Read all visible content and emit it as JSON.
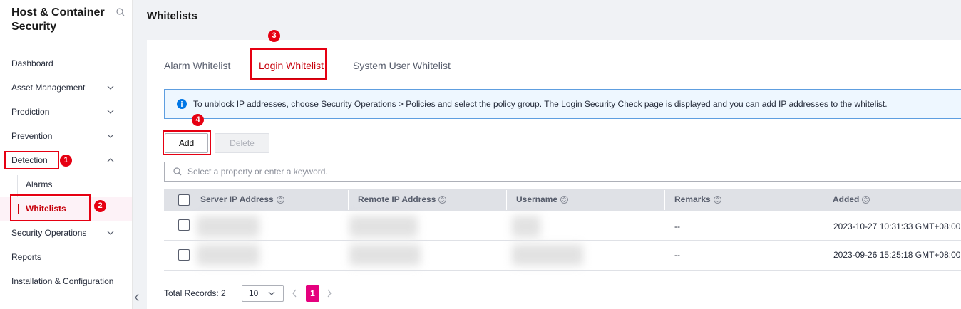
{
  "sidebar": {
    "title": "Host & Container Security",
    "items": [
      {
        "label": "Dashboard"
      },
      {
        "label": "Asset Management"
      },
      {
        "label": "Prediction"
      },
      {
        "label": "Prevention"
      },
      {
        "label": "Detection"
      },
      {
        "label": "Alarms"
      },
      {
        "label": "Whitelists"
      },
      {
        "label": "Security Operations"
      },
      {
        "label": "Reports"
      },
      {
        "label": "Installation & Configuration"
      }
    ]
  },
  "callouts": [
    "1",
    "2",
    "3",
    "4"
  ],
  "page": {
    "title": "Whitelists"
  },
  "tabs": [
    {
      "label": "Alarm Whitelist"
    },
    {
      "label": "Login Whitelist"
    },
    {
      "label": "System User Whitelist"
    }
  ],
  "info": {
    "text": "To unblock IP addresses, choose Security Operations > Policies and select the policy group. The Login Security Check page is displayed and you can add IP addresses to the whitelist."
  },
  "toolbar": {
    "add_label": "Add",
    "delete_label": "Delete"
  },
  "search": {
    "placeholder": "Select a property or enter a keyword."
  },
  "table": {
    "columns": [
      "Server IP Address",
      "Remote IP Address",
      "Username",
      "Remarks",
      "Added"
    ],
    "rows": [
      {
        "remarks": "--",
        "added": "2023-10-27 10:31:33 GMT+08:00"
      },
      {
        "remarks": "--",
        "added": "2023-09-26 15:25:18 GMT+08:00"
      }
    ]
  },
  "pagination": {
    "total_label": "Total Records: 2",
    "page_size": "10",
    "current_page": "1"
  },
  "colors": {
    "accent": "#c7000b",
    "callout": "#e60012",
    "page_active": "#e5007e"
  }
}
